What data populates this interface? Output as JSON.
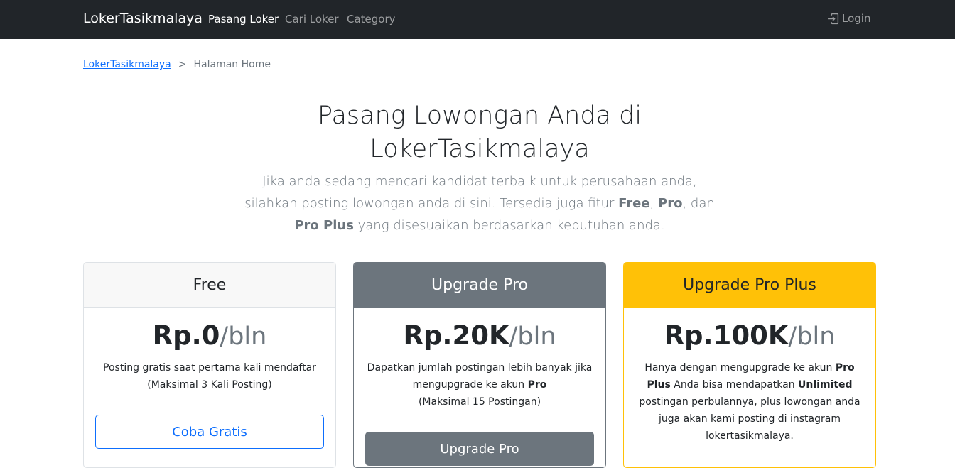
{
  "nav": {
    "brand": "LokerTasikmalaya",
    "links": [
      "Pasang Loker",
      "Cari Loker",
      "Category"
    ],
    "login": "Login"
  },
  "breadcrumb": {
    "home": "LokerTasikmalaya",
    "separator": ">",
    "current": "Halaman Home"
  },
  "hero": {
    "title": "Pasang Lowongan Anda di LokerTasikmalaya",
    "lead_1": "Jika anda sedang mencari kandidat terbaik untuk perusahaan anda, silahkan posting lowongan anda di sini. Tersedia juga fitur ",
    "lead_free": "Free",
    "lead_sep1": ", ",
    "lead_pro": "Pro",
    "lead_sep2": ", dan ",
    "lead_proplus": "Pro Plus",
    "lead_2": " yang disesuaikan berdasarkan kebutuhan anda."
  },
  "plans": [
    {
      "title": "Free",
      "price": "Rp.0",
      "per": "/bln",
      "desc_line1": "Posting gratis saat pertama kali mendaftar",
      "desc_line2": "(Maksimal 3 Kali Posting)",
      "button": "Coba Gratis"
    },
    {
      "title": "Upgrade Pro",
      "price": "Rp.20K",
      "per": "/bln",
      "desc_1": "Dapatkan jumlah postingan lebih banyak jika mengupgrade ke akun ",
      "desc_bold": "Pro",
      "desc_line2": "(Maksimal 15 Postingan)",
      "button": "Upgrade Pro"
    },
    {
      "title": "Upgrade Pro Plus",
      "price": "Rp.100K",
      "per": "/bln",
      "desc_1": "Hanya dengan mengupgrade ke akun ",
      "desc_bold1": "Pro Plus",
      "desc_2": " Anda bisa mendapatkan ",
      "desc_bold2": "Unlimited",
      "desc_3": " postingan perbulannya, plus lowongan anda juga akan kami posting di instagram lokertasikmalaya."
    }
  ],
  "colors": {
    "navbar": "#212529",
    "primary": "#0d6efd",
    "secondary": "#6c757d",
    "warning": "#ffc107"
  }
}
